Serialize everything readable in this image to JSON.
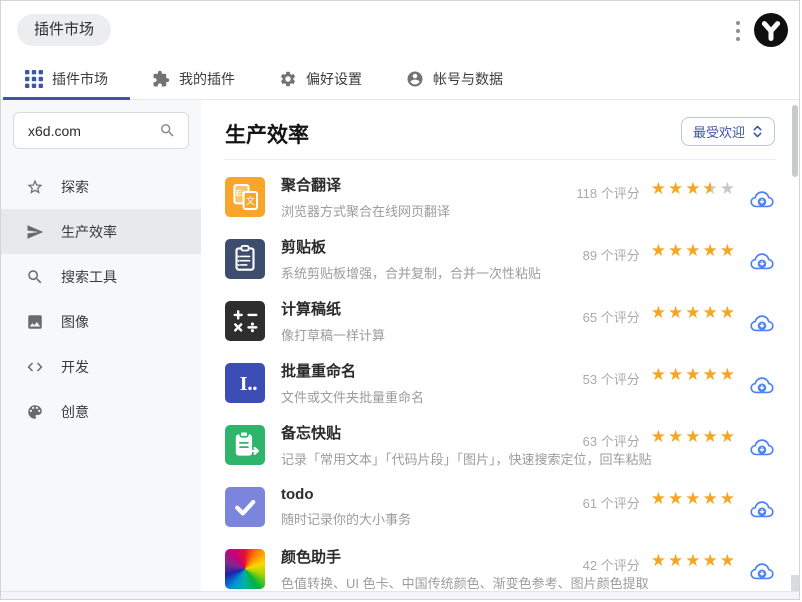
{
  "window": {
    "title_badge": "插件市场"
  },
  "colors": {
    "accent": "#3D56A8",
    "star_full": "#F5A623",
    "star_empty": "#C8C8CA",
    "cloud_blue": "#4B82F5",
    "sidebar_bg": "#F7F8F9",
    "active_item_bg": "#E8E9EB"
  },
  "tabs": [
    {
      "name": "plugin-market",
      "label": "插件市场",
      "icon": "grid-icon",
      "active": true
    },
    {
      "name": "my-plugins",
      "label": "我的插件",
      "icon": "puzzle-icon",
      "active": false
    },
    {
      "name": "preferences",
      "label": "偏好设置",
      "icon": "gear-icon",
      "active": false
    },
    {
      "name": "account-data",
      "label": "帐号与数据",
      "icon": "person-icon",
      "active": false
    }
  ],
  "sidebar": {
    "search": {
      "value": "x6d.com"
    },
    "items": [
      {
        "name": "explore",
        "label": "探索",
        "icon": "star-icon",
        "active": false
      },
      {
        "name": "productivity",
        "label": "生产效率",
        "icon": "paper-plane-icon",
        "active": true
      },
      {
        "name": "search-tools",
        "label": "搜索工具",
        "icon": "magnifier-icon",
        "active": false
      },
      {
        "name": "images",
        "label": "图像",
        "icon": "image-icon",
        "active": false
      },
      {
        "name": "develop",
        "label": "开发",
        "icon": "code-icon",
        "active": false
      },
      {
        "name": "creative",
        "label": "创意",
        "icon": "palette-icon",
        "active": false
      }
    ]
  },
  "main": {
    "title": "生产效率",
    "sort": {
      "label": "最受欢迎"
    },
    "plugins": [
      {
        "name": "聚合翻译",
        "desc": "浏览器方式聚合在线网页翻译",
        "ratings_count": "118 个评分",
        "stars": 3.5,
        "icon": "translate-icon",
        "icon_bg": "#F7A52B"
      },
      {
        "name": "剪贴板",
        "desc": "系统剪贴板增强，合并复制，合并一次性粘贴",
        "ratings_count": "89 个评分",
        "stars": 5,
        "icon": "clipboard-icon",
        "icon_bg": "#3E4C6E"
      },
      {
        "name": "计算稿纸",
        "desc": "像打草稿一样计算",
        "ratings_count": "65 个评分",
        "stars": 5,
        "icon": "calculator-icon",
        "icon_bg": "#2E2E2E"
      },
      {
        "name": "批量重命名",
        "desc": "文件或文件夹批量重命名",
        "ratings_count": "53 个评分",
        "stars": 5,
        "icon": "rename-icon",
        "icon_bg": "#3C4EB5"
      },
      {
        "name": "备忘快贴",
        "desc": "记录「常用文本」「代码片段」「图片」，快速搜索定位，回车粘贴",
        "ratings_count": "63 个评分",
        "stars": 5,
        "icon": "memo-icon",
        "icon_bg": "#2FB56B"
      },
      {
        "name": "todo",
        "desc": "随时记录你的大小事务",
        "ratings_count": "61 个评分",
        "stars": 5,
        "icon": "todo-check-icon",
        "icon_bg": "#7B85DC"
      },
      {
        "name": "颜色助手",
        "desc": "色值转换、UI 色卡、中国传统颜色、渐变色参考、图片颜色提取",
        "ratings_count": "42 个评分",
        "stars": 5,
        "icon": "color-wheel-icon",
        "icon_bg": "conic"
      }
    ]
  }
}
